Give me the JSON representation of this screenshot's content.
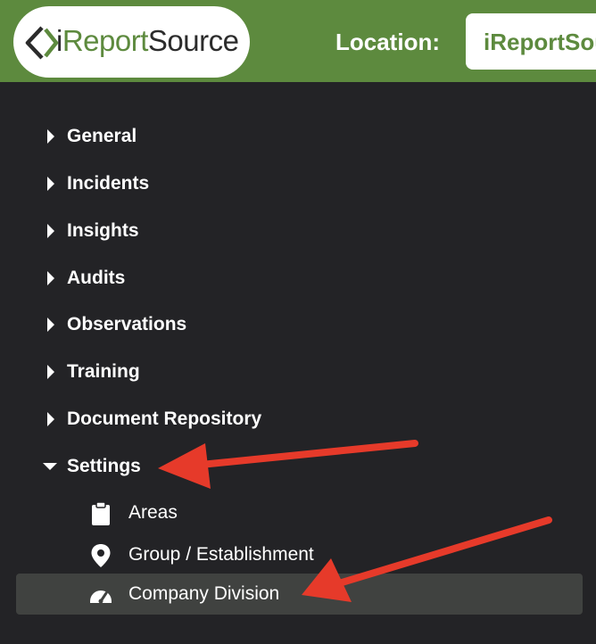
{
  "header": {
    "logo": {
      "text_prefix": "i",
      "text_accent": "Report",
      "text_suffix": "Source"
    },
    "location_label": "Location:",
    "location_value": "iReportSource"
  },
  "nav": {
    "items": [
      {
        "label": "General",
        "expanded": false
      },
      {
        "label": "Incidents",
        "expanded": false
      },
      {
        "label": "Insights",
        "expanded": false
      },
      {
        "label": "Audits",
        "expanded": false
      },
      {
        "label": "Observations",
        "expanded": false
      },
      {
        "label": "Training",
        "expanded": false
      },
      {
        "label": "Document Repository",
        "expanded": false
      },
      {
        "label": "Settings",
        "expanded": true
      }
    ],
    "settings_children": [
      {
        "label": "Areas",
        "icon": "clipboard-icon",
        "active": false
      },
      {
        "label": "Group / Establishment",
        "icon": "map-pin-icon",
        "active": false
      },
      {
        "label": "Company Division",
        "icon": "dashboard-gauge-icon",
        "active": true
      }
    ]
  },
  "colors": {
    "header_green": "#5d8a3e",
    "sidebar_bg": "#232326",
    "active_item_bg": "#404240",
    "annotation_arrow": "#e63a2a"
  }
}
